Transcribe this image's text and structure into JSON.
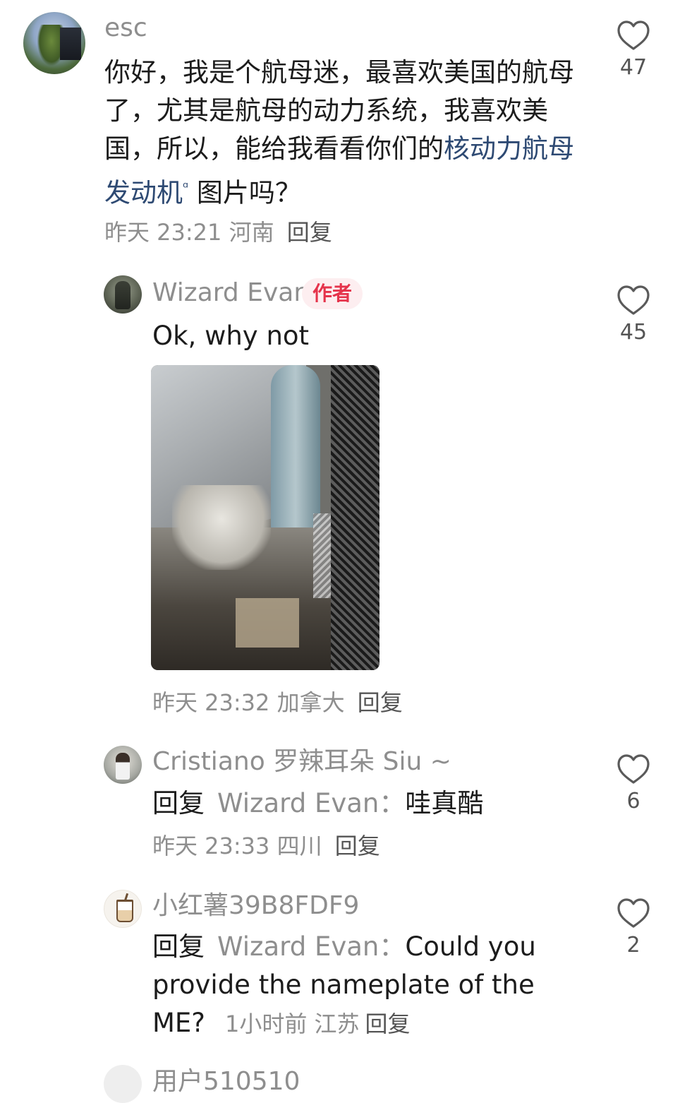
{
  "comments": [
    {
      "username": "esc",
      "text_before_link": "你好，我是个航母迷，最喜欢美国的航母了，尤其是航母的动力系统，我喜欢美国，所以，能给我看看你们的",
      "link_text": "核动力航母发动机",
      "link_icon": "search-icon",
      "text_after_link": " 图片吗？",
      "time": "昨天 23:21",
      "location": "河南",
      "reply_label": "回复",
      "likes": "47"
    },
    {
      "username": "Wizard Evan",
      "badge": "作者",
      "text": "Ok, why not",
      "image": "engine-room-photo",
      "time": "昨天 23:32",
      "location": "加拿大",
      "reply_label": "回复",
      "likes": "45"
    },
    {
      "username": "Cristiano 罗辣耳朵 Siu ~",
      "reply_prefix": "回复",
      "reply_target": "Wizard Evan：",
      "text": "哇真酷",
      "time": "昨天 23:33",
      "location": "四川",
      "reply_label": "回复",
      "likes": "6"
    },
    {
      "username": "小红薯39B8FDF9",
      "reply_prefix": "回复",
      "reply_target": "Wizard Evan：",
      "text": "Could you provide the nameplate of the ME?",
      "time": "1小时前",
      "location": "江苏",
      "reply_label": "回复",
      "likes": "2"
    }
  ],
  "partial_next": {
    "username": "用户510510"
  },
  "colors": {
    "author_badge_text": "#e5334b",
    "author_badge_bg": "#fdeef0",
    "meta_gray": "#8e8e8e",
    "link_blue": "#2e4a73"
  },
  "icons": {
    "like": "heart-outline-icon"
  }
}
